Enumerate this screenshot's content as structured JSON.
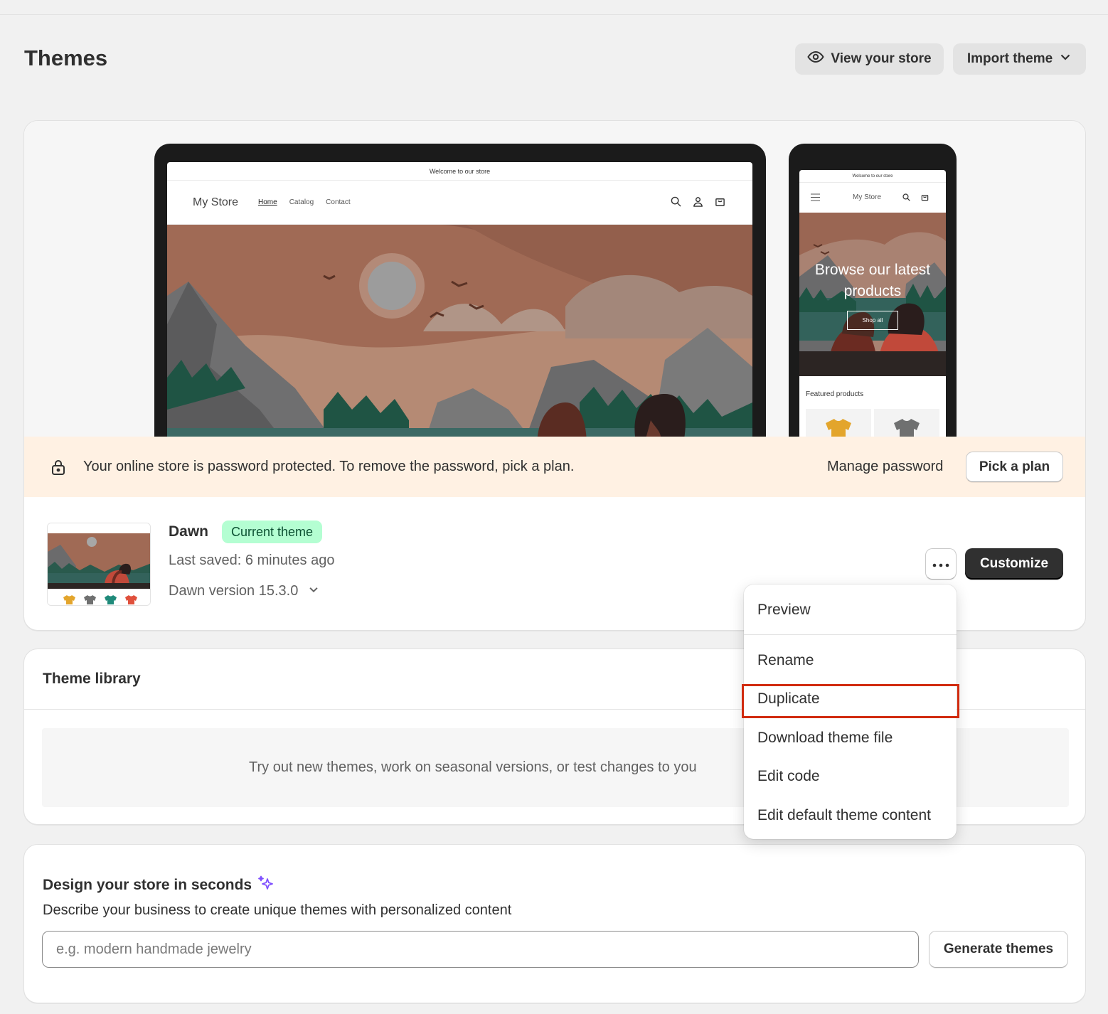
{
  "page": {
    "title": "Themes"
  },
  "header": {
    "view_store_label": "View your store",
    "import_theme_label": "Import theme"
  },
  "preview": {
    "announcement": "Welcome to our store",
    "store_name": "My Store",
    "nav_links": [
      "Home",
      "Catalog",
      "Contact"
    ],
    "mobile_hero_title": "Browse our latest products",
    "mobile_shop_all": "Shop all",
    "mobile_featured": "Featured products"
  },
  "banner": {
    "message": "Your online store is password protected. To remove the password, pick a plan.",
    "manage_password": "Manage password",
    "pick_plan": "Pick a plan"
  },
  "theme": {
    "name": "Dawn",
    "badge": "Current theme",
    "last_saved": "Last saved: 6 minutes ago",
    "version": "Dawn version 15.3.0",
    "customize_label": "Customize"
  },
  "menu": {
    "items": [
      "Preview",
      "Rename",
      "Duplicate",
      "Download theme file",
      "Edit code",
      "Edit default theme content"
    ],
    "highlighted": "Duplicate"
  },
  "library": {
    "title": "Theme library",
    "empty_text": "Try out new themes, work on seasonal versions, or test changes to you"
  },
  "design": {
    "title": "Design your store in seconds",
    "description": "Describe your business to create unique themes with personalized content",
    "input_placeholder": "e.g. modern handmade jewelry",
    "generate_label": "Generate themes"
  },
  "colors": {
    "badge_bg": "#b4fed2",
    "badge_text": "#0c5132",
    "banner_bg": "#fff1e3",
    "primary_button": "#303030",
    "highlight_border": "#d12b0f",
    "sparkle": "#8051ff"
  }
}
